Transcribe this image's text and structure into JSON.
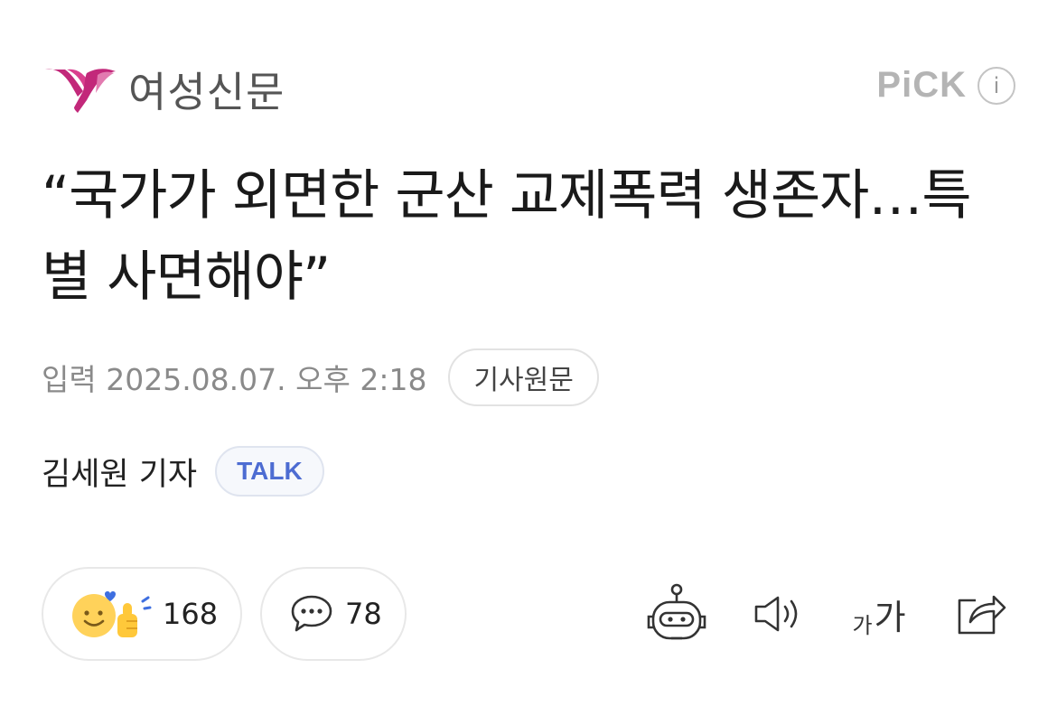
{
  "header": {
    "logo_text": "여성신문",
    "pick_label": "PiCK",
    "info_glyph": "i"
  },
  "article": {
    "title": "“국가가 외면한 군산 교제폭력 생존자…특별 사면해야”",
    "meta": "입력 2025.08.07. 오후 2:18",
    "original_button": "기사원문",
    "author": "김세원 기자",
    "talk_label": "TALK"
  },
  "reactions": {
    "like_count": "168",
    "comment_count": "78"
  },
  "tools": {
    "font_small": "가",
    "font_big": "가",
    "icons": [
      "robot-summary-icon",
      "speaker-icon",
      "font-size-icon",
      "share-icon"
    ]
  },
  "colors": {
    "logo_magenta": "#c2287a",
    "talk_blue": "#4d6cd2",
    "meta_gray": "#8a8a8a"
  }
}
